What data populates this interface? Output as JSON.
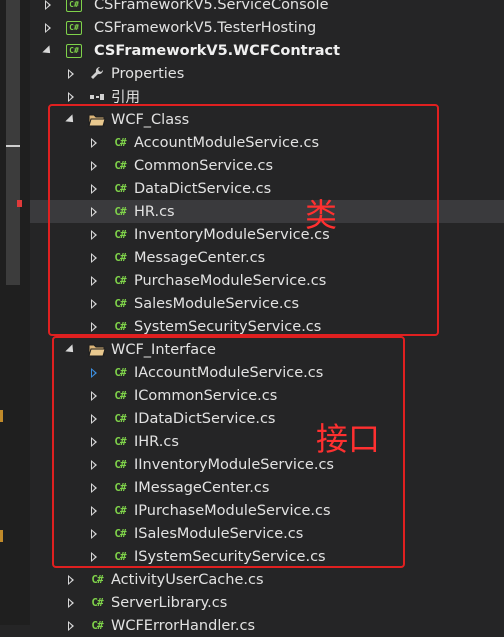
{
  "solution_tree": {
    "rows": [
      {
        "label": "CSFrameworkV5.ServiceConsole",
        "icon": "cs-project-icon",
        "state": "collapsed"
      },
      {
        "label": "CSFrameworkV5.TesterHosting",
        "icon": "cs-project-icon",
        "state": "collapsed"
      },
      {
        "label": "CSFrameworkV5.WCFContract",
        "icon": "cs-project-icon",
        "state": "expanded"
      },
      {
        "label": "Properties",
        "icon": "wrench-icon",
        "state": "collapsed"
      },
      {
        "label": "引用",
        "icon": "references-icon",
        "state": "collapsed"
      },
      {
        "label": "WCF_Class",
        "icon": "folder-open-icon",
        "state": "expanded"
      },
      {
        "label": "AccountModuleService.cs",
        "icon": "cs-file-icon",
        "state": "collapsed"
      },
      {
        "label": "CommonService.cs",
        "icon": "cs-file-icon",
        "state": "collapsed"
      },
      {
        "label": "DataDictService.cs",
        "icon": "cs-file-icon",
        "state": "collapsed"
      },
      {
        "label": "HR.cs",
        "icon": "cs-file-icon",
        "state": "collapsed",
        "selected": true
      },
      {
        "label": "InventoryModuleService.cs",
        "icon": "cs-file-icon",
        "state": "collapsed"
      },
      {
        "label": "MessageCenter.cs",
        "icon": "cs-file-icon",
        "state": "collapsed"
      },
      {
        "label": "PurchaseModuleService.cs",
        "icon": "cs-file-icon",
        "state": "collapsed"
      },
      {
        "label": "SalesModuleService.cs",
        "icon": "cs-file-icon",
        "state": "collapsed"
      },
      {
        "label": "SystemSecurityService.cs",
        "icon": "cs-file-icon",
        "state": "collapsed"
      },
      {
        "label": "WCF_Interface",
        "icon": "folder-open-icon",
        "state": "expanded"
      },
      {
        "label": "IAccountModuleService.cs",
        "icon": "cs-file-icon",
        "state": "collapsed"
      },
      {
        "label": "ICommonService.cs",
        "icon": "cs-file-icon",
        "state": "collapsed"
      },
      {
        "label": "IDataDictService.cs",
        "icon": "cs-file-icon",
        "state": "collapsed"
      },
      {
        "label": "IHR.cs",
        "icon": "cs-file-icon",
        "state": "collapsed"
      },
      {
        "label": "IInventoryModuleService.cs",
        "icon": "cs-file-icon",
        "state": "collapsed"
      },
      {
        "label": "IMessageCenter.cs",
        "icon": "cs-file-icon",
        "state": "collapsed"
      },
      {
        "label": "IPurchaseModuleService.cs",
        "icon": "cs-file-icon",
        "state": "collapsed"
      },
      {
        "label": "ISalesModuleService.cs",
        "icon": "cs-file-icon",
        "state": "collapsed"
      },
      {
        "label": "ISystemSecurityService.cs",
        "icon": "cs-file-icon",
        "state": "collapsed"
      },
      {
        "label": "ActivityUserCache.cs",
        "icon": "cs-file-icon",
        "state": "collapsed"
      },
      {
        "label": "ServerLibrary.cs",
        "icon": "cs-file-icon",
        "state": "collapsed"
      },
      {
        "label": "WCFErrorHandler.cs",
        "icon": "cs-file-icon",
        "state": "collapsed"
      }
    ]
  },
  "annotations": {
    "class_label": "类",
    "interface_label": "接口"
  },
  "colors": {
    "background": "#252526",
    "cs_green": "#7fd24a",
    "annotation_red": "#e02020",
    "folder_tan": "#dcb67a"
  }
}
